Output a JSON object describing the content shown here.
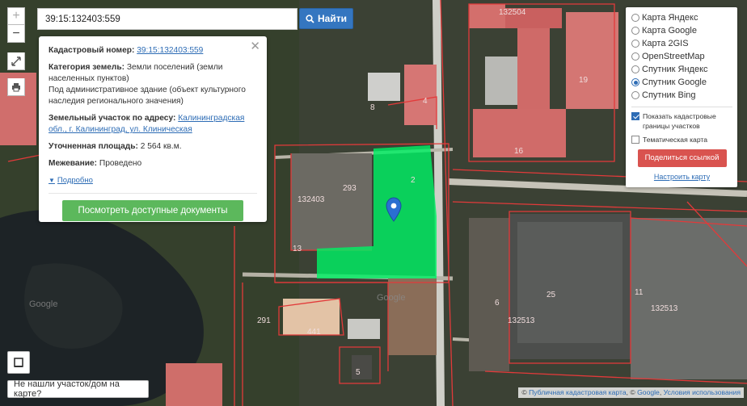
{
  "search": {
    "value": "39:15:132403:559",
    "button_label": "Найти"
  },
  "map": {
    "labels": {
      "block_top": "132504",
      "block_mid": "132403",
      "block_low": "132513",
      "right_block": "132513",
      "n293": "293",
      "n291": "291",
      "n8": "8",
      "n4": "4",
      "n16": "16",
      "n19": "19",
      "n13": "13",
      "n11": "11",
      "n5": "5",
      "n441": "441",
      "n2": "2",
      "n6": "6",
      "n25": "25"
    },
    "watermarks": [
      "Google",
      "Google"
    ],
    "colors": {
      "parcel": "#00f064",
      "boundary": "#e23a3a",
      "pin": "#2a6fd1"
    }
  },
  "info": {
    "cadastral_label": "Кадастровый номер:",
    "cadastral_value": "39:15:132403:559",
    "category_label": "Категория земель:",
    "category_value": "Земли поселений (земли населенных пунктов)",
    "purpose": "Под административное здание (объект культурного наследия регионального значения)",
    "address_label": "Земельный участок по адресу:",
    "address_value": "Калининградская обл., г. Калининград, ул. Клиническая",
    "area_label": "Уточненная площадь:",
    "area_value": "2 564 кв.м.",
    "survey_label": "Межевание:",
    "survey_value": "Проведено",
    "details_link": "Подробно",
    "docs_button": "Посмотреть доступные документы"
  },
  "layers": {
    "options": [
      {
        "label": "Карта Яндекс",
        "selected": false
      },
      {
        "label": "Карта Google",
        "selected": false
      },
      {
        "label": "Карта 2GIS",
        "selected": false
      },
      {
        "label": "OpenStreetMap",
        "selected": false
      },
      {
        "label": "Спутник Яндекс",
        "selected": false
      },
      {
        "label": "Спутник Google",
        "selected": true
      },
      {
        "label": "Спутник Bing",
        "selected": false
      }
    ],
    "show_boundaries": "Показать кадастровые границы участков",
    "thematic": "Тематическая карта",
    "share_button": "Поделиться ссылкой",
    "setup_link": "Настроить карту"
  },
  "tools": {
    "zoom_in": "+",
    "zoom_out": "−"
  },
  "bottom": {
    "not_found": "Не нашли участок/дом на карте?",
    "attrib_sign": "©",
    "attrib_pkk": "Публичная кадастровая карта",
    "attrib_sep": ", ©",
    "attrib_google": "Google",
    "attrib_terms": "Условия использования"
  }
}
